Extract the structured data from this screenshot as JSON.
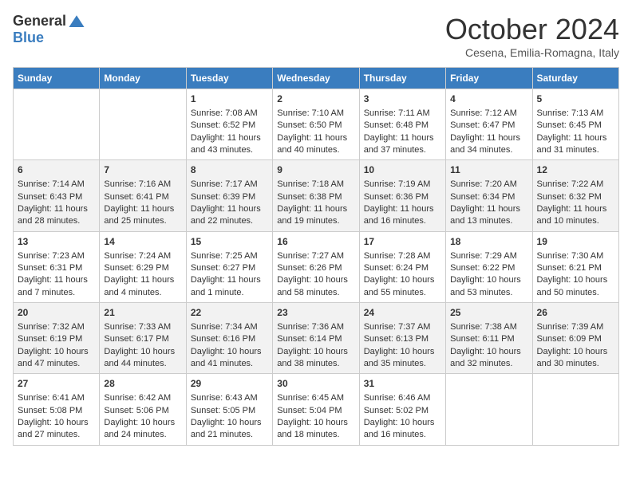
{
  "header": {
    "logo_line1": "General",
    "logo_line2": "Blue",
    "month": "October 2024",
    "location": "Cesena, Emilia-Romagna, Italy"
  },
  "days_of_week": [
    "Sunday",
    "Monday",
    "Tuesday",
    "Wednesday",
    "Thursday",
    "Friday",
    "Saturday"
  ],
  "weeks": [
    [
      {
        "day": "",
        "content": ""
      },
      {
        "day": "",
        "content": ""
      },
      {
        "day": "1",
        "content": "Sunrise: 7:08 AM\nSunset: 6:52 PM\nDaylight: 11 hours and 43 minutes."
      },
      {
        "day": "2",
        "content": "Sunrise: 7:10 AM\nSunset: 6:50 PM\nDaylight: 11 hours and 40 minutes."
      },
      {
        "day": "3",
        "content": "Sunrise: 7:11 AM\nSunset: 6:48 PM\nDaylight: 11 hours and 37 minutes."
      },
      {
        "day": "4",
        "content": "Sunrise: 7:12 AM\nSunset: 6:47 PM\nDaylight: 11 hours and 34 minutes."
      },
      {
        "day": "5",
        "content": "Sunrise: 7:13 AM\nSunset: 6:45 PM\nDaylight: 11 hours and 31 minutes."
      }
    ],
    [
      {
        "day": "6",
        "content": "Sunrise: 7:14 AM\nSunset: 6:43 PM\nDaylight: 11 hours and 28 minutes."
      },
      {
        "day": "7",
        "content": "Sunrise: 7:16 AM\nSunset: 6:41 PM\nDaylight: 11 hours and 25 minutes."
      },
      {
        "day": "8",
        "content": "Sunrise: 7:17 AM\nSunset: 6:39 PM\nDaylight: 11 hours and 22 minutes."
      },
      {
        "day": "9",
        "content": "Sunrise: 7:18 AM\nSunset: 6:38 PM\nDaylight: 11 hours and 19 minutes."
      },
      {
        "day": "10",
        "content": "Sunrise: 7:19 AM\nSunset: 6:36 PM\nDaylight: 11 hours and 16 minutes."
      },
      {
        "day": "11",
        "content": "Sunrise: 7:20 AM\nSunset: 6:34 PM\nDaylight: 11 hours and 13 minutes."
      },
      {
        "day": "12",
        "content": "Sunrise: 7:22 AM\nSunset: 6:32 PM\nDaylight: 11 hours and 10 minutes."
      }
    ],
    [
      {
        "day": "13",
        "content": "Sunrise: 7:23 AM\nSunset: 6:31 PM\nDaylight: 11 hours and 7 minutes."
      },
      {
        "day": "14",
        "content": "Sunrise: 7:24 AM\nSunset: 6:29 PM\nDaylight: 11 hours and 4 minutes."
      },
      {
        "day": "15",
        "content": "Sunrise: 7:25 AM\nSunset: 6:27 PM\nDaylight: 11 hours and 1 minute."
      },
      {
        "day": "16",
        "content": "Sunrise: 7:27 AM\nSunset: 6:26 PM\nDaylight: 10 hours and 58 minutes."
      },
      {
        "day": "17",
        "content": "Sunrise: 7:28 AM\nSunset: 6:24 PM\nDaylight: 10 hours and 55 minutes."
      },
      {
        "day": "18",
        "content": "Sunrise: 7:29 AM\nSunset: 6:22 PM\nDaylight: 10 hours and 53 minutes."
      },
      {
        "day": "19",
        "content": "Sunrise: 7:30 AM\nSunset: 6:21 PM\nDaylight: 10 hours and 50 minutes."
      }
    ],
    [
      {
        "day": "20",
        "content": "Sunrise: 7:32 AM\nSunset: 6:19 PM\nDaylight: 10 hours and 47 minutes."
      },
      {
        "day": "21",
        "content": "Sunrise: 7:33 AM\nSunset: 6:17 PM\nDaylight: 10 hours and 44 minutes."
      },
      {
        "day": "22",
        "content": "Sunrise: 7:34 AM\nSunset: 6:16 PM\nDaylight: 10 hours and 41 minutes."
      },
      {
        "day": "23",
        "content": "Sunrise: 7:36 AM\nSunset: 6:14 PM\nDaylight: 10 hours and 38 minutes."
      },
      {
        "day": "24",
        "content": "Sunrise: 7:37 AM\nSunset: 6:13 PM\nDaylight: 10 hours and 35 minutes."
      },
      {
        "day": "25",
        "content": "Sunrise: 7:38 AM\nSunset: 6:11 PM\nDaylight: 10 hours and 32 minutes."
      },
      {
        "day": "26",
        "content": "Sunrise: 7:39 AM\nSunset: 6:09 PM\nDaylight: 10 hours and 30 minutes."
      }
    ],
    [
      {
        "day": "27",
        "content": "Sunrise: 6:41 AM\nSunset: 5:08 PM\nDaylight: 10 hours and 27 minutes."
      },
      {
        "day": "28",
        "content": "Sunrise: 6:42 AM\nSunset: 5:06 PM\nDaylight: 10 hours and 24 minutes."
      },
      {
        "day": "29",
        "content": "Sunrise: 6:43 AM\nSunset: 5:05 PM\nDaylight: 10 hours and 21 minutes."
      },
      {
        "day": "30",
        "content": "Sunrise: 6:45 AM\nSunset: 5:04 PM\nDaylight: 10 hours and 18 minutes."
      },
      {
        "day": "31",
        "content": "Sunrise: 6:46 AM\nSunset: 5:02 PM\nDaylight: 10 hours and 16 minutes."
      },
      {
        "day": "",
        "content": ""
      },
      {
        "day": "",
        "content": ""
      }
    ]
  ]
}
